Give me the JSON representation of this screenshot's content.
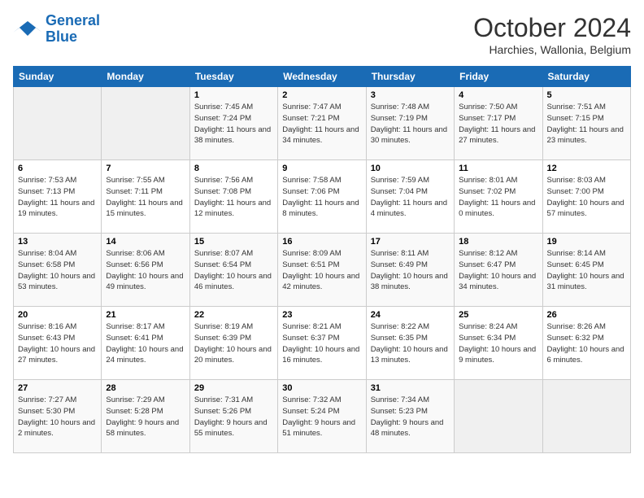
{
  "header": {
    "logo_line1": "General",
    "logo_line2": "Blue",
    "month": "October 2024",
    "location": "Harchies, Wallonia, Belgium"
  },
  "columns": [
    "Sunday",
    "Monday",
    "Tuesday",
    "Wednesday",
    "Thursday",
    "Friday",
    "Saturday"
  ],
  "weeks": [
    [
      {
        "day": "",
        "detail": ""
      },
      {
        "day": "",
        "detail": ""
      },
      {
        "day": "1",
        "detail": "Sunrise: 7:45 AM\nSunset: 7:24 PM\nDaylight: 11 hours and 38 minutes."
      },
      {
        "day": "2",
        "detail": "Sunrise: 7:47 AM\nSunset: 7:21 PM\nDaylight: 11 hours and 34 minutes."
      },
      {
        "day": "3",
        "detail": "Sunrise: 7:48 AM\nSunset: 7:19 PM\nDaylight: 11 hours and 30 minutes."
      },
      {
        "day": "4",
        "detail": "Sunrise: 7:50 AM\nSunset: 7:17 PM\nDaylight: 11 hours and 27 minutes."
      },
      {
        "day": "5",
        "detail": "Sunrise: 7:51 AM\nSunset: 7:15 PM\nDaylight: 11 hours and 23 minutes."
      }
    ],
    [
      {
        "day": "6",
        "detail": "Sunrise: 7:53 AM\nSunset: 7:13 PM\nDaylight: 11 hours and 19 minutes."
      },
      {
        "day": "7",
        "detail": "Sunrise: 7:55 AM\nSunset: 7:11 PM\nDaylight: 11 hours and 15 minutes."
      },
      {
        "day": "8",
        "detail": "Sunrise: 7:56 AM\nSunset: 7:08 PM\nDaylight: 11 hours and 12 minutes."
      },
      {
        "day": "9",
        "detail": "Sunrise: 7:58 AM\nSunset: 7:06 PM\nDaylight: 11 hours and 8 minutes."
      },
      {
        "day": "10",
        "detail": "Sunrise: 7:59 AM\nSunset: 7:04 PM\nDaylight: 11 hours and 4 minutes."
      },
      {
        "day": "11",
        "detail": "Sunrise: 8:01 AM\nSunset: 7:02 PM\nDaylight: 11 hours and 0 minutes."
      },
      {
        "day": "12",
        "detail": "Sunrise: 8:03 AM\nSunset: 7:00 PM\nDaylight: 10 hours and 57 minutes."
      }
    ],
    [
      {
        "day": "13",
        "detail": "Sunrise: 8:04 AM\nSunset: 6:58 PM\nDaylight: 10 hours and 53 minutes."
      },
      {
        "day": "14",
        "detail": "Sunrise: 8:06 AM\nSunset: 6:56 PM\nDaylight: 10 hours and 49 minutes."
      },
      {
        "day": "15",
        "detail": "Sunrise: 8:07 AM\nSunset: 6:54 PM\nDaylight: 10 hours and 46 minutes."
      },
      {
        "day": "16",
        "detail": "Sunrise: 8:09 AM\nSunset: 6:51 PM\nDaylight: 10 hours and 42 minutes."
      },
      {
        "day": "17",
        "detail": "Sunrise: 8:11 AM\nSunset: 6:49 PM\nDaylight: 10 hours and 38 minutes."
      },
      {
        "day": "18",
        "detail": "Sunrise: 8:12 AM\nSunset: 6:47 PM\nDaylight: 10 hours and 34 minutes."
      },
      {
        "day": "19",
        "detail": "Sunrise: 8:14 AM\nSunset: 6:45 PM\nDaylight: 10 hours and 31 minutes."
      }
    ],
    [
      {
        "day": "20",
        "detail": "Sunrise: 8:16 AM\nSunset: 6:43 PM\nDaylight: 10 hours and 27 minutes."
      },
      {
        "day": "21",
        "detail": "Sunrise: 8:17 AM\nSunset: 6:41 PM\nDaylight: 10 hours and 24 minutes."
      },
      {
        "day": "22",
        "detail": "Sunrise: 8:19 AM\nSunset: 6:39 PM\nDaylight: 10 hours and 20 minutes."
      },
      {
        "day": "23",
        "detail": "Sunrise: 8:21 AM\nSunset: 6:37 PM\nDaylight: 10 hours and 16 minutes."
      },
      {
        "day": "24",
        "detail": "Sunrise: 8:22 AM\nSunset: 6:35 PM\nDaylight: 10 hours and 13 minutes."
      },
      {
        "day": "25",
        "detail": "Sunrise: 8:24 AM\nSunset: 6:34 PM\nDaylight: 10 hours and 9 minutes."
      },
      {
        "day": "26",
        "detail": "Sunrise: 8:26 AM\nSunset: 6:32 PM\nDaylight: 10 hours and 6 minutes."
      }
    ],
    [
      {
        "day": "27",
        "detail": "Sunrise: 7:27 AM\nSunset: 5:30 PM\nDaylight: 10 hours and 2 minutes."
      },
      {
        "day": "28",
        "detail": "Sunrise: 7:29 AM\nSunset: 5:28 PM\nDaylight: 9 hours and 58 minutes."
      },
      {
        "day": "29",
        "detail": "Sunrise: 7:31 AM\nSunset: 5:26 PM\nDaylight: 9 hours and 55 minutes."
      },
      {
        "day": "30",
        "detail": "Sunrise: 7:32 AM\nSunset: 5:24 PM\nDaylight: 9 hours and 51 minutes."
      },
      {
        "day": "31",
        "detail": "Sunrise: 7:34 AM\nSunset: 5:23 PM\nDaylight: 9 hours and 48 minutes."
      },
      {
        "day": "",
        "detail": ""
      },
      {
        "day": "",
        "detail": ""
      }
    ]
  ]
}
